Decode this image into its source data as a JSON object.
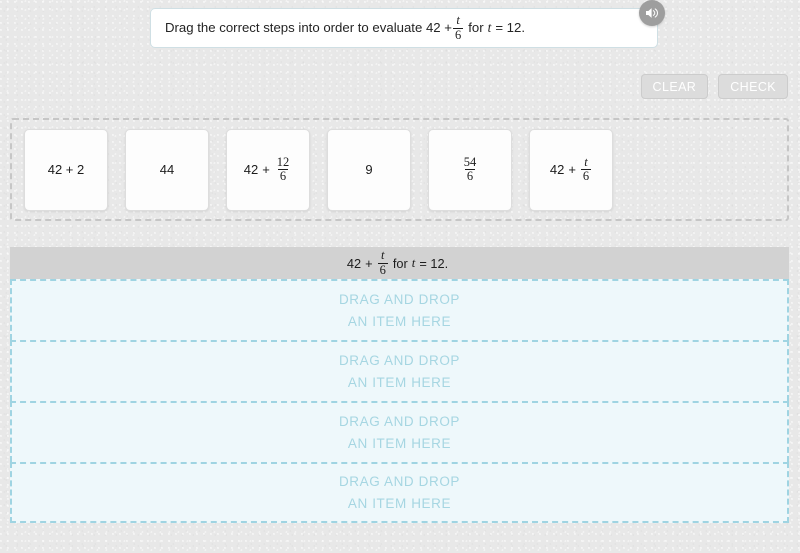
{
  "instruction": {
    "prefix": "Drag the correct steps into order to evaluate 42 +",
    "frac_num": "t",
    "frac_den": "6",
    "suffix_for": "for",
    "suffix_var": "t",
    "suffix_eq": "= 12."
  },
  "speaker": {
    "icon": "speaker-icon"
  },
  "actions": {
    "clear_label": "CLEAR",
    "check_label": "CHECK"
  },
  "tiles": [
    {
      "kind": "plain",
      "text": "42 + 2"
    },
    {
      "kind": "plain",
      "text": "44"
    },
    {
      "kind": "sum_frac",
      "lead": "42",
      "op": "+",
      "num": "12",
      "den": "6",
      "italic_num": false
    },
    {
      "kind": "plain",
      "text": "9"
    },
    {
      "kind": "frac",
      "num": "54",
      "den": "6",
      "italic_num": false
    },
    {
      "kind": "sum_frac",
      "lead": "42",
      "op": "+",
      "num": "t",
      "den": "6",
      "italic_num": true
    }
  ],
  "answer_header": {
    "lead": "42",
    "op": "+",
    "num": "t",
    "den": "6",
    "tail_for": "for",
    "tail_var": "t",
    "tail_eq": "= 12."
  },
  "dropzones": [
    {
      "line1": "DRAG AND DROP",
      "line2": "AN ITEM HERE"
    },
    {
      "line1": "DRAG AND DROP",
      "line2": "AN ITEM HERE"
    },
    {
      "line1": "DRAG AND DROP",
      "line2": "AN ITEM HERE"
    },
    {
      "line1": "DRAG AND DROP",
      "line2": "AN ITEM HERE"
    }
  ],
  "colors": {
    "page_bg": "#e8e8e8",
    "dropzone_bg": "#eef8fb",
    "dropzone_border": "#9fd4e2",
    "dropzone_text": "#a6d6e2",
    "header_bar": "#d2d2d2",
    "button_bg": "#dcdcdc",
    "tile_bank_border": "#c6c6c6"
  }
}
